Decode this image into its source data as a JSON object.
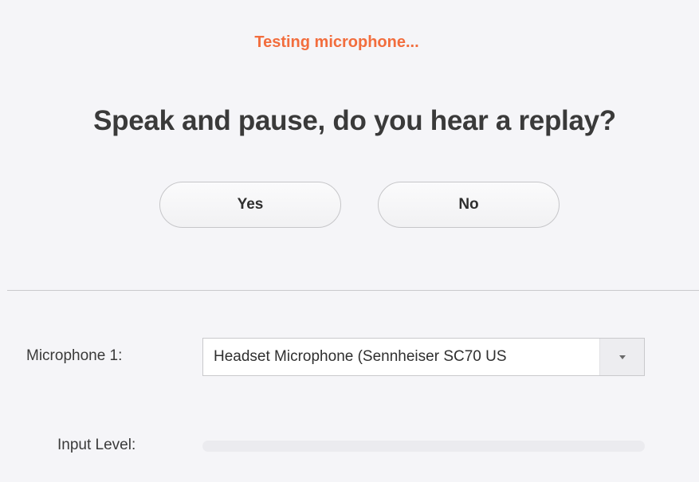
{
  "test": {
    "status": "Testing microphone...",
    "question": "Speak and pause, do you hear a replay?",
    "yes_label": "Yes",
    "no_label": "No"
  },
  "settings": {
    "microphone_label": "Microphone 1:",
    "microphone_value": "Headset Microphone (Sennheiser SC70 US",
    "input_level_label": "Input Level:",
    "input_level": 0
  },
  "icons": {
    "dropdown": "chevron-down-icon"
  },
  "colors": {
    "status": "#f26d3d",
    "background": "#f5f5f8"
  }
}
